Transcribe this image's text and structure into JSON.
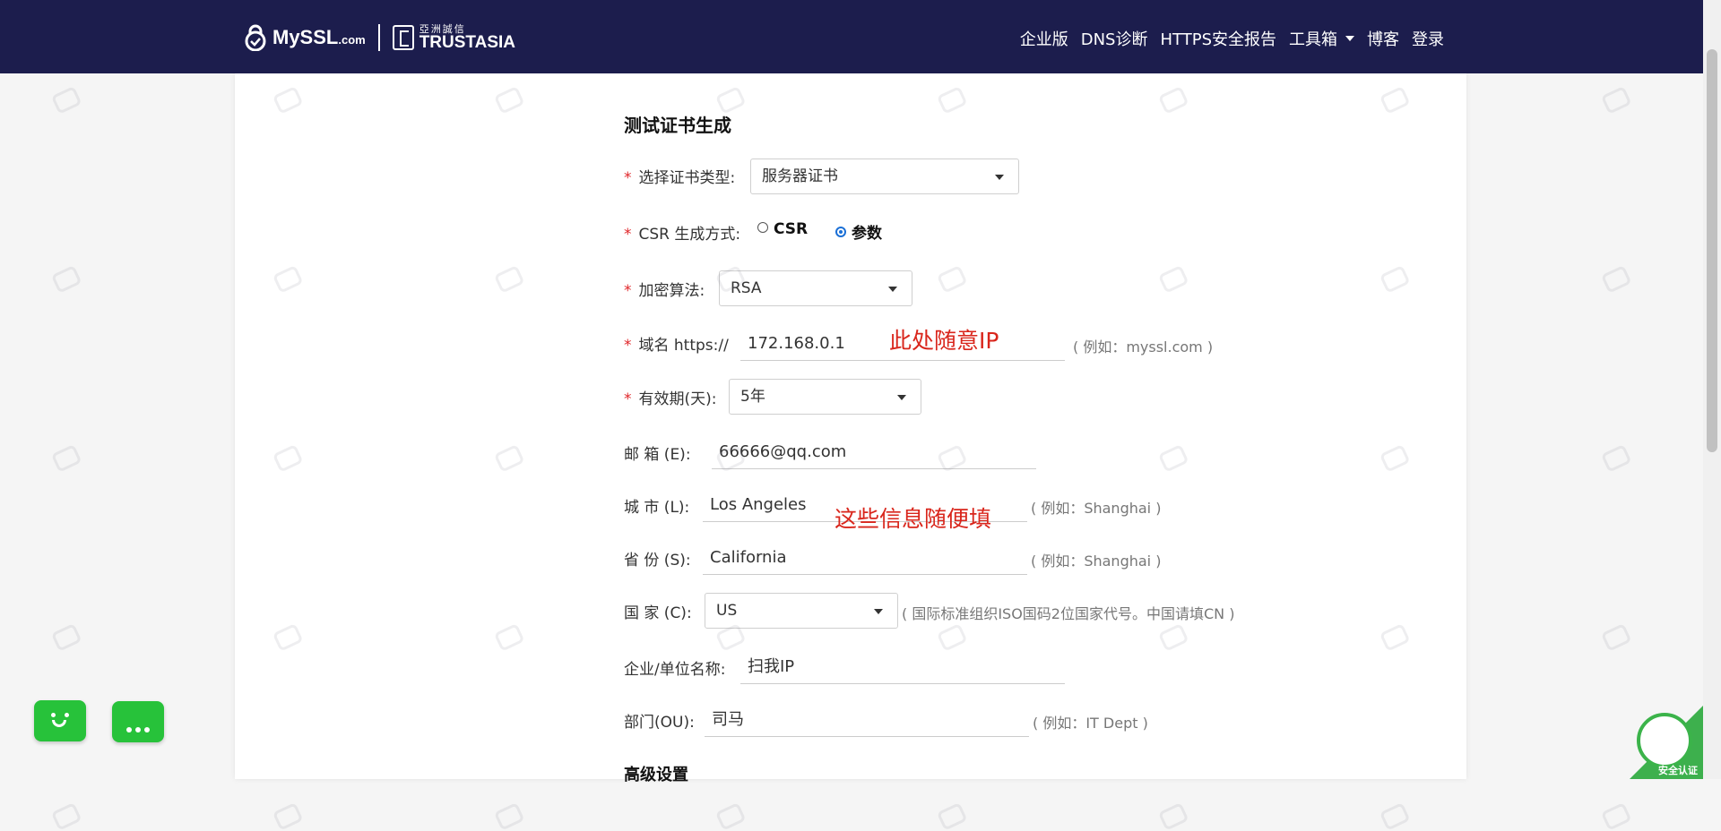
{
  "header": {
    "logo_main": "MySSL",
    "logo_suffix": ".com",
    "partner_cn": "亞洲誠信",
    "partner_en": "TRUSTASIA",
    "nav": [
      "企业版",
      "DNS诊断",
      "HTTPS安全报告",
      "工具箱",
      "博客",
      "登录"
    ]
  },
  "form": {
    "title": "测试证书生成",
    "cert_type": {
      "label": "选择证书类型:",
      "value": "服务器证书"
    },
    "csr_method": {
      "label": "CSR 生成方式:",
      "options": [
        "CSR",
        "参数"
      ],
      "selected": "参数"
    },
    "algorithm": {
      "label": "加密算法:",
      "value": "RSA"
    },
    "domain": {
      "label": "域名 https://",
      "value": "172.168.0.1",
      "hint": "( 例如：myssl.com )"
    },
    "validity": {
      "label": "有效期(天):",
      "value": "5年"
    },
    "email": {
      "label": "邮  箱 (E):",
      "value": "66666@qq.com"
    },
    "city": {
      "label": "城  市 (L):",
      "value": "Los Angeles",
      "hint": "( 例如：Shanghai )"
    },
    "state": {
      "label": "省  份 (S):",
      "value": "California",
      "hint": "( 例如：Shanghai )"
    },
    "country": {
      "label": "国  家 (C):",
      "value": "US",
      "hint": "( 国际标准组织ISO国码2位国家代号。中国请填CN )"
    },
    "org": {
      "label": "企业/单位名称:",
      "value": "扫我IP"
    },
    "ou": {
      "label": "部门(OU):",
      "value": "司马",
      "hint": "( 例如：IT Dept )"
    },
    "advanced": "高级设置"
  },
  "annotations": {
    "domain_note": "此处随意IP",
    "info_note": "这些信息随便填"
  },
  "badge": {
    "text": "安全认证"
  },
  "colors": {
    "header_bg": "#1c1d4d",
    "required": "#e0262a",
    "annotation": "#d9261c",
    "chat_green": "#27c23a"
  }
}
